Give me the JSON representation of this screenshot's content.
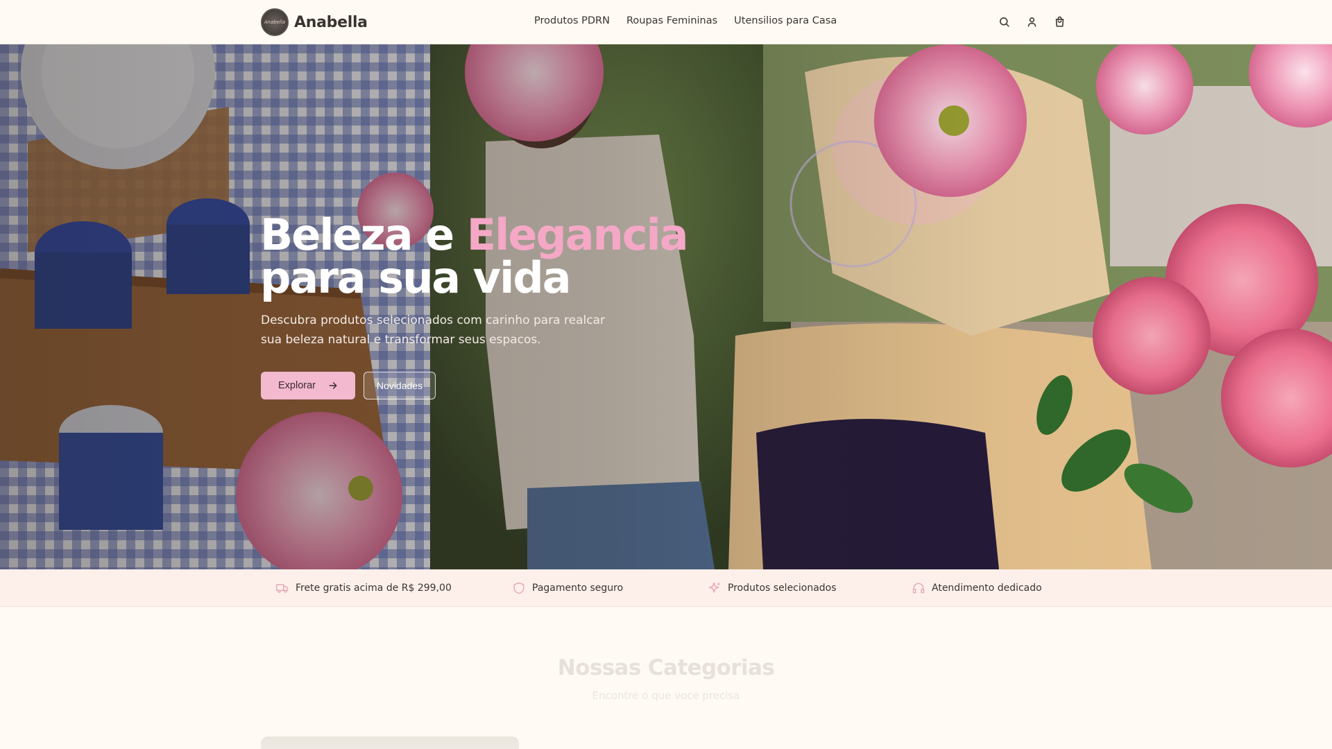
{
  "header": {
    "brand": "Anabella",
    "logo_text": "Anabella",
    "nav": [
      "Produtos PDRN",
      "Roupas Femininas",
      "Utensilios para Casa"
    ],
    "icons": [
      "search-icon",
      "user-icon",
      "shopping-bag-icon"
    ]
  },
  "hero": {
    "title_part1": "Beleza e ",
    "title_accent": "Elegancia",
    "title_part2": "para sua vida",
    "subtitle": "Descubra produtos selecionados com carinho para realcar sua beleza natural e transformar seus espacos.",
    "primary_button": "Explorar",
    "secondary_button": "Novidades",
    "accent_color": "#f4a8c6"
  },
  "features": [
    {
      "icon": "truck-icon",
      "label": "Frete gratis acima de R$ 299,00"
    },
    {
      "icon": "shield-icon",
      "label": "Pagamento seguro"
    },
    {
      "icon": "sparkles-icon",
      "label": "Produtos selecionados"
    },
    {
      "icon": "headphones-icon",
      "label": "Atendimento dedicado"
    }
  ],
  "categories": {
    "title": "Nossas Categorias",
    "subtitle": "Encontre o que voce precisa"
  }
}
